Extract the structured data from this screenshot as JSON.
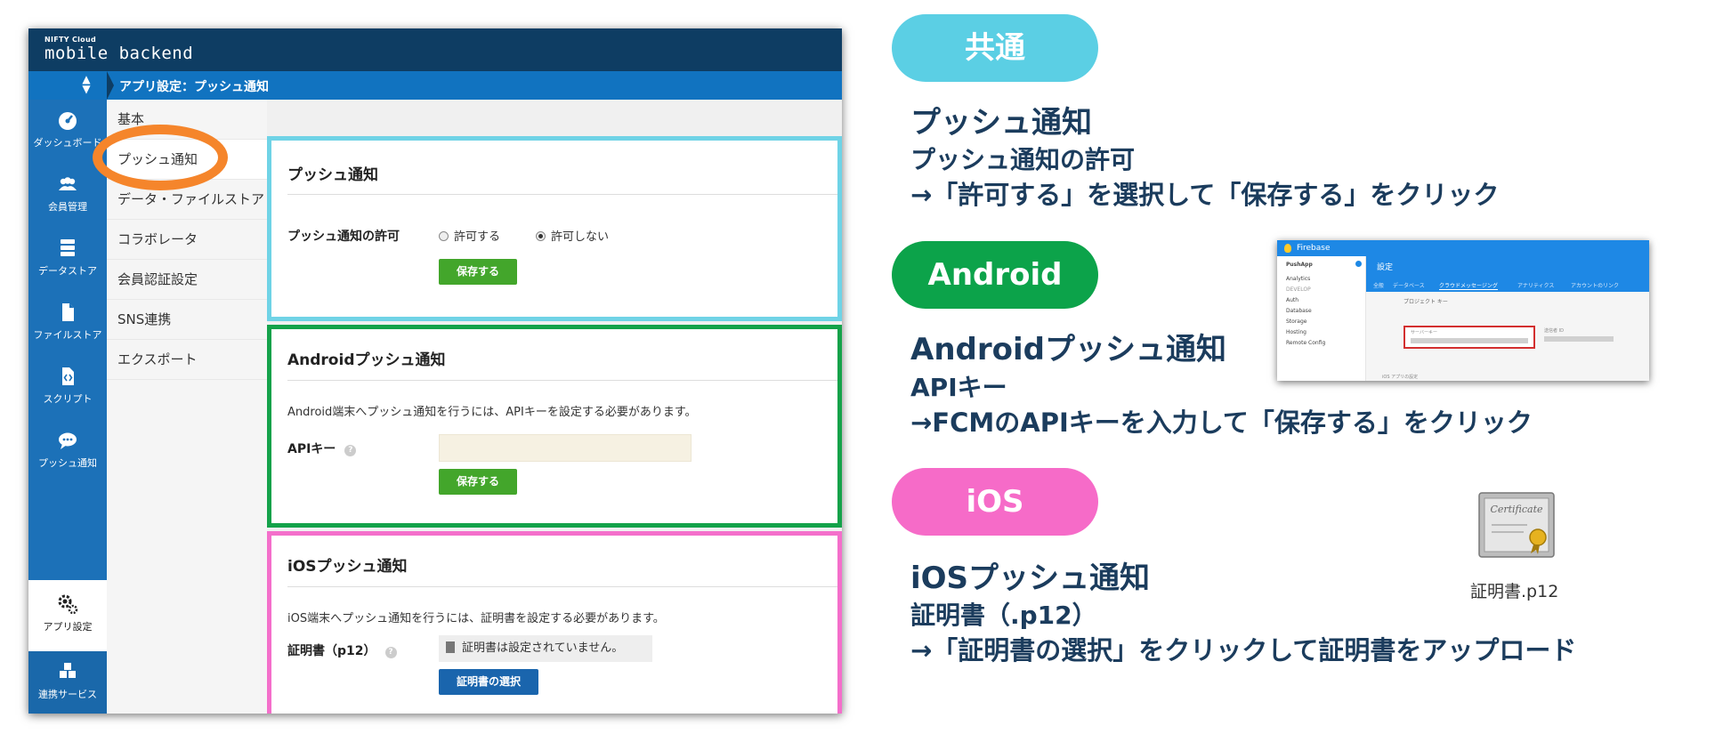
{
  "app": {
    "brand_small": "NIFTY Cloud",
    "brand": "mobile backend",
    "page_title": "アプリ設定：プッシュ通知",
    "sidebar_icons": [
      {
        "label": "ダッシュボード",
        "icon": "dashboard-icon"
      },
      {
        "label": "会員管理",
        "icon": "users-icon"
      },
      {
        "label": "データストア",
        "icon": "database-icon"
      },
      {
        "label": "ファイルストア",
        "icon": "file-icon"
      },
      {
        "label": "スクリプト",
        "icon": "script-icon"
      },
      {
        "label": "プッシュ通知",
        "icon": "chat-bubble-icon"
      },
      {
        "label": "アプリ設定",
        "icon": "gears-icon"
      },
      {
        "label": "連携サービス",
        "icon": "cubes-icon"
      }
    ],
    "settings_menu": [
      "基本",
      "プッシュ通知",
      "データ・ファイルストア",
      "コラボレータ",
      "会員認証設定",
      "SNS連携",
      "エクスポート"
    ],
    "push_panel": {
      "title": "プッシュ通知",
      "permission_label": "プッシュ通知の許可",
      "allow": "許可する",
      "deny": "許可しない",
      "save": "保存する"
    },
    "android_panel": {
      "title": "Androidプッシュ通知",
      "description": "Android端末へプッシュ通知を行うには、APIキーを設定する必要があります。",
      "api_key_label": "APIキー",
      "help": "?",
      "save": "保存する"
    },
    "ios_panel": {
      "title": "iOSプッシュ通知",
      "description": "iOS端末へプッシュ通知を行うには、証明書を設定する必要があります。",
      "cert_label": "証明書（p12）",
      "help": "?",
      "cert_status": "証明書は設定されていません。",
      "select_button": "証明書の選択"
    }
  },
  "sections": {
    "common": {
      "badge": "共通",
      "badge_color": "#5bcfe4",
      "title": "プッシュ通知",
      "subtitle": "プッシュ通知の許可",
      "instruction": "→「許可する」を選択して「保存する」をクリック"
    },
    "android": {
      "badge": "Android",
      "badge_color": "#0ca34a",
      "title": "Androidプッシュ通知",
      "subtitle": "APIキー",
      "instruction": "→FCMのAPIキーを入力して「保存する」をクリック"
    },
    "ios": {
      "badge": "iOS",
      "badge_color": "#f66bc8",
      "title": "iOSプッシュ通知",
      "subtitle": "証明書（.p12）",
      "instruction": "→「証明書の選択」をクリックして証明書をアップロード"
    }
  },
  "firebase": {
    "brand": "Firebase",
    "project": "PushApp",
    "settings": "設定",
    "tabs": [
      "全般",
      "データベース",
      "クラウドメッセージング",
      "アナリティクス",
      "アカウントのリンク"
    ],
    "side_items": [
      "Analytics",
      "DEVELOP",
      "Auth",
      "Database",
      "Storage",
      "Hosting",
      "Remote Config"
    ],
    "project_keys": "プロジェクト キー",
    "server_key": "サーバーキー",
    "sender_id": "送信者 ID",
    "ios_settings": "iOS アプリの設定"
  },
  "certificate": {
    "icon_text": "Certificate",
    "filename": "証明書.p12"
  },
  "colors": {
    "common_border": "#6fd3e6",
    "android_border": "#14a24a",
    "ios_border": "#f46fcb",
    "highlight": "#f5852b"
  }
}
